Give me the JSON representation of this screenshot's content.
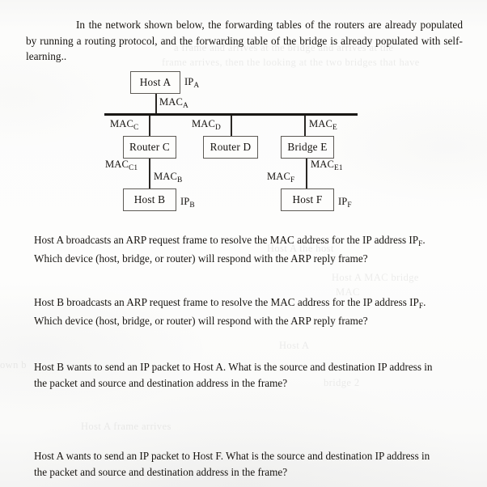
{
  "document": {
    "type": "scanned-worksheet",
    "intro": "In the network shown below, the forwarding tables of the routers are already populated by running a routing protocol, and the forwarding table of the bridge is already populated with self-learning..",
    "intro_indent": ""
  },
  "diagram": {
    "nodes": [
      {
        "id": "host-a",
        "label": "Host A",
        "kind": "host"
      },
      {
        "id": "router-c",
        "label": "Router C",
        "kind": "router"
      },
      {
        "id": "router-d",
        "label": "Router D",
        "kind": "router"
      },
      {
        "id": "bridge-e",
        "label": "Bridge E",
        "kind": "bridge"
      },
      {
        "id": "host-b",
        "label": "Host B",
        "kind": "host"
      },
      {
        "id": "host-f",
        "label": "Host F",
        "kind": "host"
      }
    ],
    "ip_labels": [
      {
        "id": "ip-a",
        "text": "IP",
        "sub": "A"
      },
      {
        "id": "ip-b",
        "text": "IP",
        "sub": "B"
      },
      {
        "id": "ip-f",
        "text": "IP",
        "sub": "F"
      }
    ],
    "mac_labels": [
      {
        "id": "mac-a",
        "text": "MAC",
        "sub": "A"
      },
      {
        "id": "mac-c",
        "text": "MAC",
        "sub": "C"
      },
      {
        "id": "mac-d",
        "text": "MAC",
        "sub": "D"
      },
      {
        "id": "mac-e",
        "text": "MAC",
        "sub": "E"
      },
      {
        "id": "mac-c1",
        "text": "MAC",
        "sub": "C1"
      },
      {
        "id": "mac-b",
        "text": "MAC",
        "sub": "B"
      },
      {
        "id": "mac-f",
        "text": "MAC",
        "sub": "F"
      },
      {
        "id": "mac-e1",
        "text": "MAC",
        "sub": "E1"
      }
    ]
  },
  "questions": [
    {
      "id": "q1",
      "line1_a": "Host A broadcasts an ARP request frame to resolve the MAC address for the IP address IP",
      "line1_sub": "F",
      "line1_b": ".",
      "line2": "Which device (host, bridge, or router) will respond with the ARP reply frame?"
    },
    {
      "id": "q2",
      "line1_a": "Host B broadcasts an ARP request frame to resolve the MAC address for the IP address IP",
      "line1_sub": "F",
      "line1_b": ".",
      "line2": "Which device (host, bridge, or router) will respond with the ARP reply frame?"
    },
    {
      "id": "q3",
      "line1_a": "Host B wants to send an IP packet to Host A. What is the source and destination IP address in",
      "line1_sub": "",
      "line1_b": "",
      "line2": "the packet and source and destination address in the frame?"
    },
    {
      "id": "q4",
      "line1_a": "Host A wants to send an IP packet to Host F. What is the source and destination IP address in",
      "line1_sub": "",
      "line1_b": "",
      "line2": "the packet and source and destination address in the frame?"
    }
  ],
  "bleed_through": [
    {
      "id": "ghost-1",
      "text": "a frame and arrives at the bridge and arrives at the"
    },
    {
      "id": "ghost-2",
      "text": "frame arrives, then the looking at the two bridges that have"
    }
  ],
  "colors": {
    "paper": "#fbfbfa",
    "ink": "#15120f",
    "box_border": "#5d5a55",
    "bus_line": "#191714"
  }
}
